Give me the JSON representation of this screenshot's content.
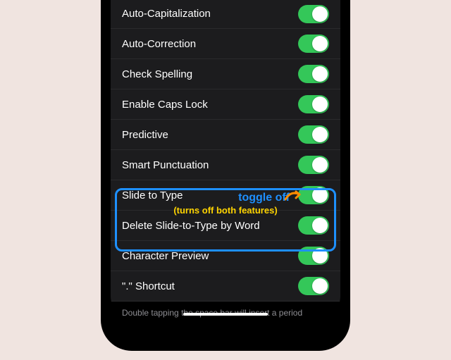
{
  "settings": [
    {
      "label": "Auto-Capitalization",
      "on": true
    },
    {
      "label": "Auto-Correction",
      "on": true
    },
    {
      "label": "Check Spelling",
      "on": true
    },
    {
      "label": "Enable Caps Lock",
      "on": true
    },
    {
      "label": "Predictive",
      "on": true
    },
    {
      "label": "Smart Punctuation",
      "on": true
    },
    {
      "label": "Slide to Type",
      "on": true
    },
    {
      "label": "Delete Slide-to-Type by Word",
      "on": true
    },
    {
      "label": "Character Preview",
      "on": true
    },
    {
      "label": "\".\" Shortcut",
      "on": true
    }
  ],
  "footer": "Double tapping the space bar will insert a period followed by a space.",
  "annotation": {
    "main": "toggle off",
    "sub": "(turns off both features)"
  }
}
